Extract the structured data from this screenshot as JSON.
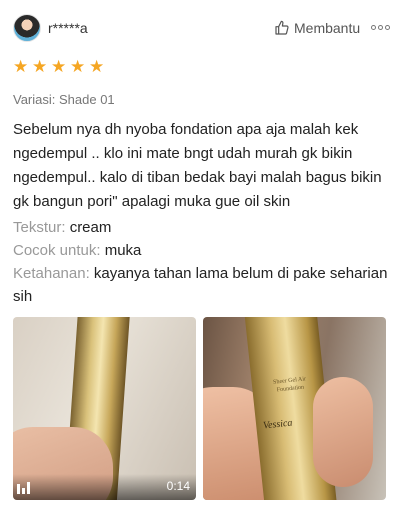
{
  "review": {
    "username": "r*****a",
    "helpful_label": "Membantu",
    "rating": 5,
    "star_glyph": "★",
    "variant": "Variasi: Shade 01",
    "text": "Sebelum nya dh nyoba fondation apa aja malah kek ngedempul .. klo ini mate bngt udah murah gk bikin ngedempul.. kalo di tiban bedak bayi malah bagus bikin gk bangun pori\" apalagi muka gue oil skin",
    "attributes": [
      {
        "key": "Tekstur:",
        "value": "cream"
      },
      {
        "key": "Cocok untuk:",
        "value": "muka"
      },
      {
        "key": "Ketahanan:",
        "value": "kayanya tahan lama belum di pake seharian sih"
      }
    ],
    "media": {
      "video_duration": "0:14",
      "photo_label": "Sheer Gel Air Foundation",
      "photo_brand": "Vessica"
    }
  },
  "colors": {
    "star": "#f5a623",
    "muted": "#999999",
    "text": "#222222"
  },
  "icons": [
    "avatar",
    "thumbs-up-icon",
    "more-icon",
    "star-icon",
    "video-icon"
  ]
}
